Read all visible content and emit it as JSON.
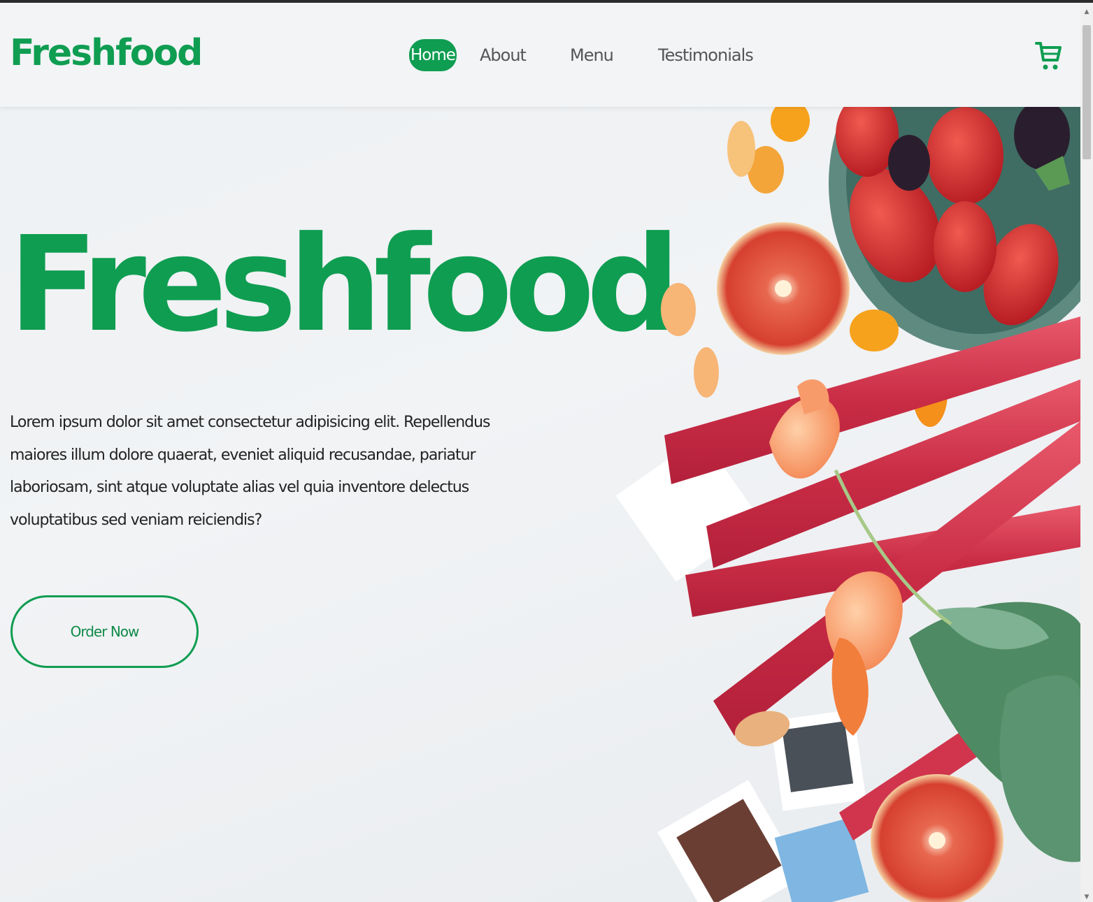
{
  "header": {
    "logo": "Freshfood",
    "nav": [
      {
        "label": "Home",
        "active": true
      },
      {
        "label": "About",
        "active": false
      },
      {
        "label": "Menu",
        "active": false
      },
      {
        "label": "Testimonials",
        "active": false
      }
    ],
    "cart_icon": "shopping-cart-icon"
  },
  "hero": {
    "title": "Freshfood",
    "description": "Lorem ipsum dolor sit amet consectetur adipisicing elit. Repellendus maiores illum dolore quaerat, eveniet aliquid recusandae, pariatur laboriosam, sint atque voluptate alias vel quia inventore delectus voluptatibus sed veniam reiciendis?",
    "order_button": "Order Now",
    "image": "fruits-rhubarb-flowers-photo"
  },
  "colors": {
    "brand_green": "#0f9d51",
    "nav_text": "#555555",
    "background": "#f1f3f5"
  }
}
